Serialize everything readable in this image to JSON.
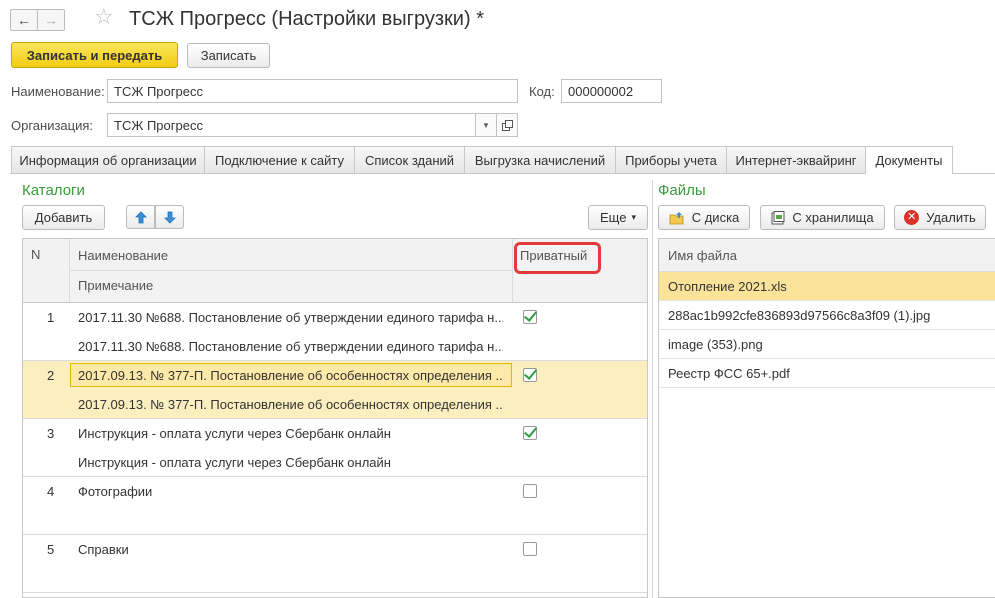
{
  "window": {
    "title": "ТСЖ Прогресс (Настройки выгрузки) *",
    "back_glyph": "←",
    "forward_glyph": "→",
    "star_glyph": "☆"
  },
  "toolbar": {
    "save_send_label": "Записать и передать",
    "save_label": "Записать"
  },
  "form": {
    "name_label": "Наименование:",
    "name_value": "ТСЖ Прогресс",
    "code_label": "Код:",
    "code_value": "000000002",
    "org_label": "Организация:",
    "org_value": "ТСЖ Прогресс"
  },
  "tabs": [
    {
      "label": "Информация об организации"
    },
    {
      "label": "Подключение к сайту"
    },
    {
      "label": "Список зданий"
    },
    {
      "label": "Выгрузка начислений"
    },
    {
      "label": "Приборы учета"
    },
    {
      "label": "Интернет-эквайринг"
    },
    {
      "label": "Документы",
      "active": true
    }
  ],
  "catalogs": {
    "title": "Каталоги",
    "add_label": "Добавить",
    "more_label": "Еще",
    "columns": {
      "n": "N",
      "name": "Наименование",
      "note": "Примечание",
      "private": "Приватный"
    },
    "rows": [
      {
        "n": "1",
        "name": "2017.11.30 №688. Постановление об утверждении единого тарифа н...",
        "note": "2017.11.30 №688. Постановление об утверждении единого тарифа н...",
        "private": true
      },
      {
        "n": "2",
        "name": "2017.09.13. № 377-П. Постановление об особенностях определения ...",
        "note": "2017.09.13. № 377-П. Постановление об особенностях определения ...",
        "private": true,
        "selected": true
      },
      {
        "n": "3",
        "name": "Инструкция - оплата услуги через Сбербанк онлайн",
        "note": "Инструкция - оплата услуги через Сбербанк онлайн",
        "private": true
      },
      {
        "n": "4",
        "name": "Фотографии",
        "note": "",
        "private": false
      },
      {
        "n": "5",
        "name": "Справки",
        "note": "",
        "private": false
      }
    ]
  },
  "files": {
    "title": "Файлы",
    "from_disk_label": "С диска",
    "from_storage_label": "С хранилища",
    "delete_label": "Удалить",
    "column": "Имя файла",
    "rows": [
      {
        "name": "Отопление 2021.xls",
        "selected": true
      },
      {
        "name": "288ac1b992cfe836893d97566c8a3f09 (1).jpg"
      },
      {
        "name": "image (353).png"
      },
      {
        "name": "Реестр ФСС 65+.pdf"
      }
    ]
  },
  "colors": {
    "accent_green": "#3a9c3a",
    "primary_button": "#f2cc12",
    "highlight_red": "#e33b3b",
    "selection": "#fbe49a"
  }
}
